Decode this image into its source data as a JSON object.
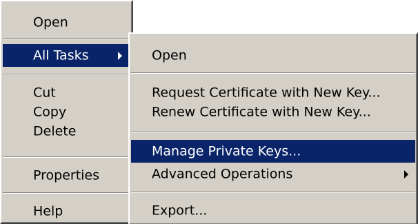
{
  "context_menu": {
    "items": [
      {
        "label": "Open"
      },
      {
        "label": "All Tasks"
      },
      {
        "label": "Cut"
      },
      {
        "label": "Copy"
      },
      {
        "label": "Delete"
      },
      {
        "label": "Properties"
      },
      {
        "label": "Help"
      }
    ],
    "highlighted": "All Tasks"
  },
  "submenu": {
    "items": [
      {
        "label": "Open"
      },
      {
        "label": "Request Certificate with New Key..."
      },
      {
        "label": "Renew Certificate with New Key..."
      },
      {
        "label": "Manage Private Keys..."
      },
      {
        "label": "Advanced Operations"
      },
      {
        "label": "Export..."
      }
    ],
    "highlighted": "Manage Private Keys..."
  },
  "colors": {
    "menu_face": "#d4d0c8",
    "highlight": "#0a246a",
    "highlight_text": "#ffffff",
    "text": "#000000"
  },
  "icons": [
    "submenu-arrow-icon"
  ]
}
